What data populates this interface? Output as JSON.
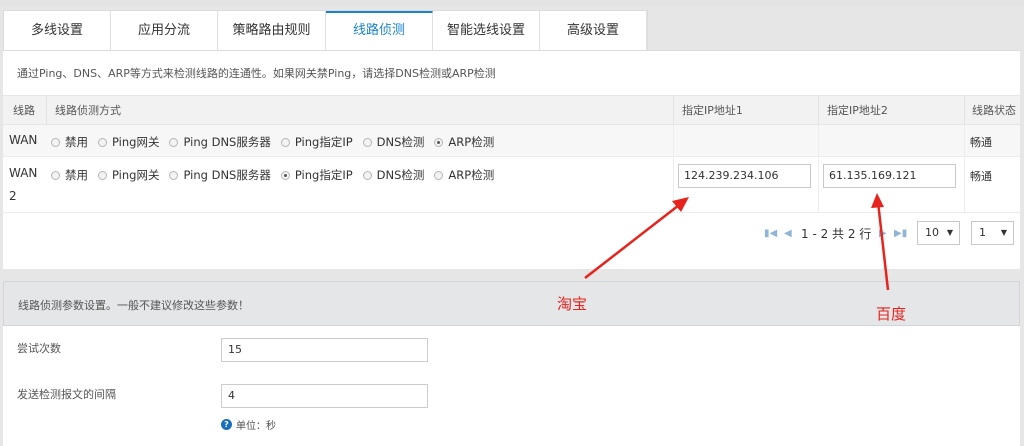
{
  "tabs": [
    {
      "label": "多线设置",
      "active": false
    },
    {
      "label": "应用分流",
      "active": false
    },
    {
      "label": "策略路由规则",
      "active": false
    },
    {
      "label": "线路侦测",
      "active": true
    },
    {
      "label": "智能选线设置",
      "active": false
    },
    {
      "label": "高级设置",
      "active": false
    }
  ],
  "description": "通过Ping、DNS、ARP等方式来检测线路的连通性。如果网关禁Ping，请选择DNS检测或ARP检测",
  "table": {
    "headers": {
      "line": "线路",
      "method": "线路侦测方式",
      "ip1": "指定IP地址1",
      "ip2": "指定IP地址2",
      "status": "线路状态"
    },
    "radio_options": [
      "禁用",
      "Ping网关",
      "Ping DNS服务器",
      "Ping指定IP",
      "DNS检测",
      "ARP检测"
    ],
    "rows": [
      {
        "line": "WAN",
        "line2": "",
        "selected": "ARP检测",
        "ip1": "",
        "ip2": "",
        "status": "畅通"
      },
      {
        "line": "WAN",
        "line2": "2",
        "selected": "Ping指定IP",
        "ip1": "124.239.234.106",
        "ip2": "61.135.169.121",
        "status": "畅通"
      }
    ]
  },
  "pagination": {
    "range_text": "1 - 2 共 2 行",
    "page_size": "10",
    "page": "1"
  },
  "params": {
    "header": "线路侦测参数设置。一般不建议修改这些参数！",
    "try_label": "尝试次数",
    "try_value": "15",
    "interval_label": "发送检测报文的间隔",
    "interval_value": "4",
    "unit_hint": "单位：秒"
  },
  "annotations": {
    "taobao": "淘宝",
    "baidu": "百度",
    "color": "#e8221c"
  },
  "colors": {
    "accent": "#1a83c9"
  }
}
